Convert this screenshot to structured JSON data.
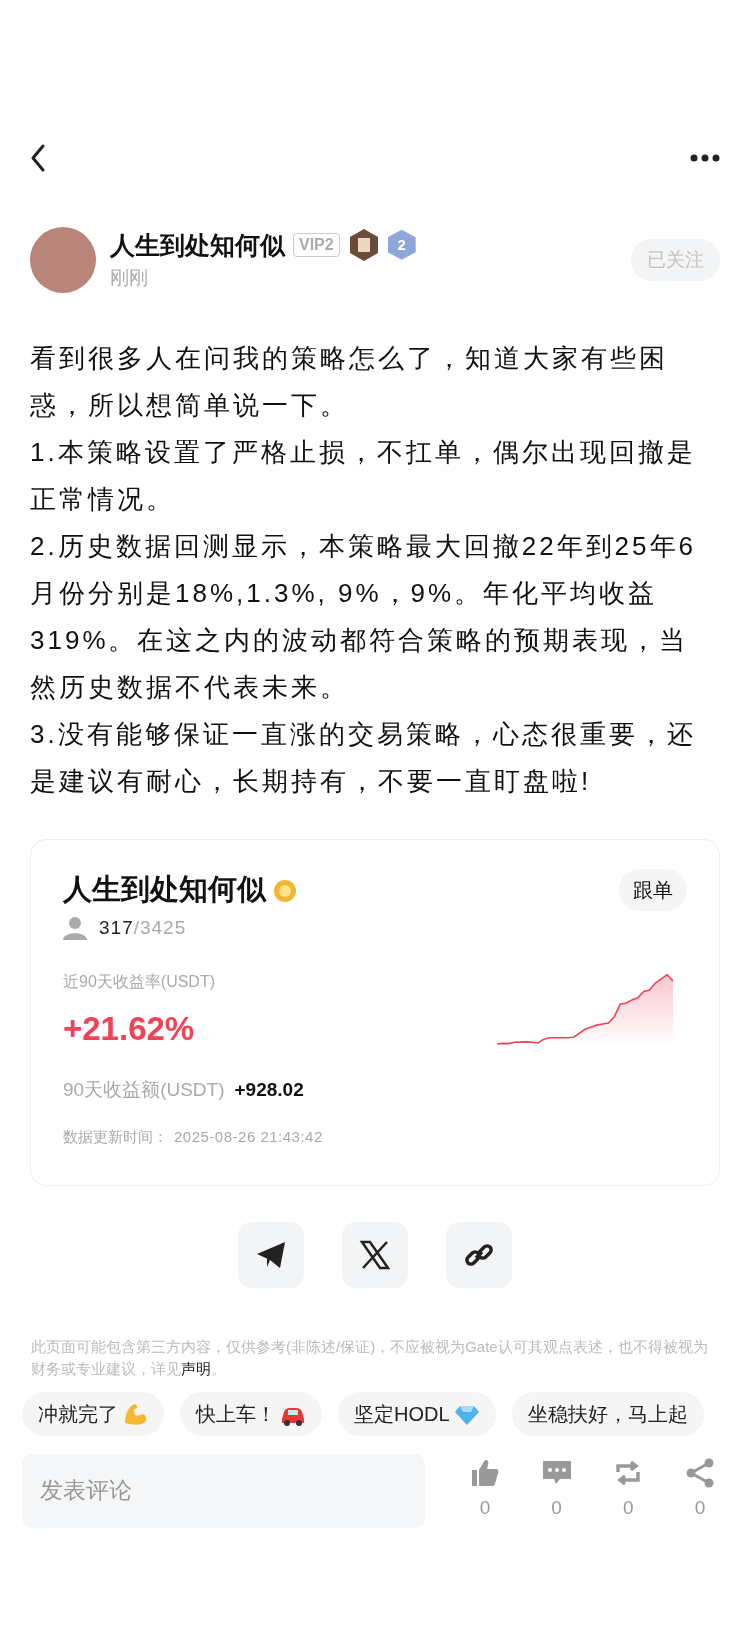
{
  "author": {
    "name": "人生到处知何似",
    "vip": "VIP2",
    "level": "2",
    "time": "刚刚",
    "follow_label": "已关注"
  },
  "post": {
    "paragraphs": [
      "看到很多人在问我的策略怎么了，知道大家有些困惑，所以想简单说一下。",
      "1.本策略设置了严格止损，不扛单，偶尔出现回撤是正常情况。",
      "2.历史数据回测显示，本策略最大回撤22年到25年6月份分别是18%,1.3%, 9%，9%。年化平均收益319%。在这之内的波动都符合策略的预期表现，当然历史数据不代表未来。",
      "3.没有能够保证一直涨的交易策略，心态很重要，还是建议有耐心，长期持有，不要一直盯盘啦!"
    ]
  },
  "strategy_card": {
    "name": "人生到处知何似",
    "follow_button": "跟单",
    "followers": "317",
    "followers_max": "/3425",
    "rate_label": "近90天收益率(USDT)",
    "rate": "+21.62%",
    "profit_label": "90天收益额(USDT)",
    "profit": "+928.02",
    "updated_label": "数据更新时间：",
    "updated": "2025-08-26 21:43:42"
  },
  "share_buttons": [
    {
      "kind": "telegram"
    },
    {
      "kind": "x"
    },
    {
      "kind": "link"
    }
  ],
  "disclaimer": "此页面可能包含第三方内容，仅供参考(非陈述/保证)，不应被视为Gate认可其观点表述，也不得被视为财务或专业建议，详见**声明**。",
  "quick_replies": [
    {
      "text": "冲就完了",
      "kind": "arm"
    },
    {
      "text": "快上车！",
      "kind": "car"
    },
    {
      "text": "坚定HODL",
      "kind": "diamond"
    },
    {
      "text": "坐稳扶好，马上起",
      "kind": "plain"
    }
  ],
  "comment_field": {
    "placeholder": "发表评论"
  },
  "actions": [
    {
      "kind": "like",
      "count": "0"
    },
    {
      "kind": "comment",
      "count": "0"
    },
    {
      "kind": "repost",
      "count": "0"
    },
    {
      "kind": "share",
      "count": "0"
    }
  ]
}
